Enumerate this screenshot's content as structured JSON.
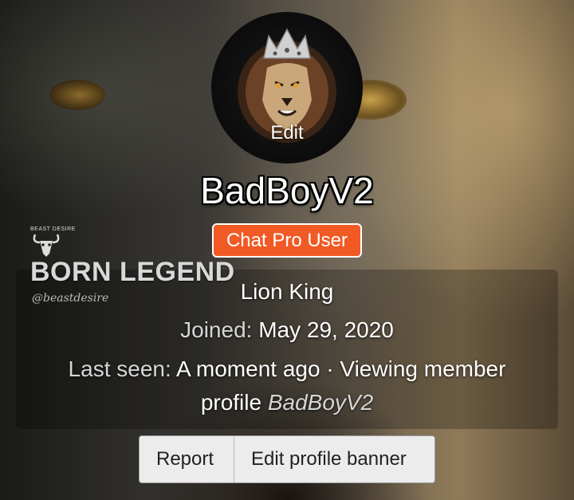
{
  "avatar": {
    "edit_label": "Edit"
  },
  "profile": {
    "username": "BadBoyV2",
    "badge": "Chat Pro User",
    "custom_title": "Lion King",
    "joined_label": "Joined:",
    "joined_value": "May 29, 2020",
    "last_seen_label": "Last seen:",
    "last_seen_value_part1": "A moment ago · Viewing member",
    "last_seen_value_part2": "profile",
    "last_seen_value_italic": "BadBoyV2"
  },
  "banner_logo": {
    "top_text": "BEAST DESIRE",
    "main_text": "BORN LEGEND",
    "signature": "@beastdesire"
  },
  "actions": {
    "report_label": "Report",
    "edit_banner_label": "Edit profile banner"
  },
  "colors": {
    "badge_bg": "#f15a24",
    "button_bg": "#ececec"
  }
}
